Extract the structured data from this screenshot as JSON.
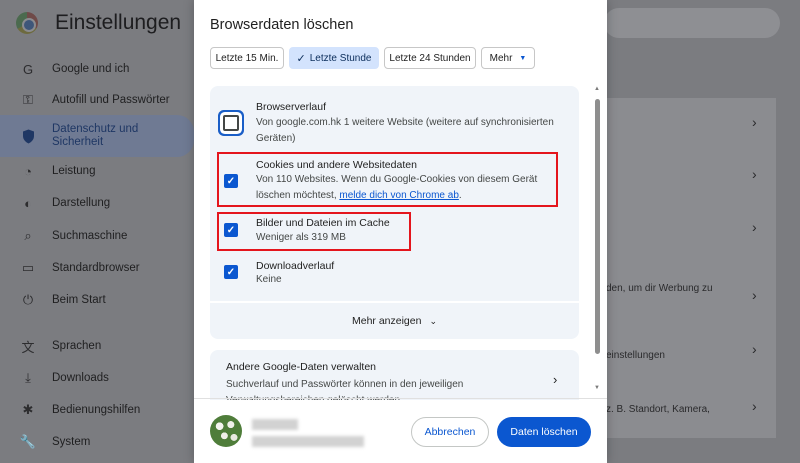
{
  "background": {
    "title": "Einstellungen",
    "sidebar": [
      {
        "label": "Google und ich",
        "icon": "google-icon"
      },
      {
        "label": "Autofill und Passwörter",
        "icon": "key-icon"
      },
      {
        "label": "Datenschutz und\nSicherheit",
        "icon": "shield-icon",
        "active": true
      },
      {
        "label": "Leistung",
        "icon": "speedometer-icon"
      },
      {
        "label": "Darstellung",
        "icon": "palette-icon"
      },
      {
        "label": "Suchmaschine",
        "icon": "search-icon"
      },
      {
        "label": "Standardbrowser",
        "icon": "browser-icon"
      },
      {
        "label": "Beim Start",
        "icon": "power-icon"
      },
      {
        "label": "Sprachen",
        "icon": "translate-icon"
      },
      {
        "label": "Downloads",
        "icon": "download-icon"
      },
      {
        "label": "Bedienungshilfen",
        "icon": "accessibility-icon"
      },
      {
        "label": "System",
        "icon": "wrench-icon"
      }
    ],
    "right_snippets": [
      "den, um dir Werbung zu",
      "einstellungen",
      "z. B. Standort, Kamera,"
    ]
  },
  "dialog": {
    "title": "Browserdaten löschen",
    "time_ranges": [
      {
        "label": "Letzte 15 Min.",
        "selected": false
      },
      {
        "label": "Letzte Stunde",
        "selected": true
      },
      {
        "label": "Letzte 24 Stunden",
        "selected": false
      },
      {
        "label": "Mehr",
        "selected": false,
        "dropdown": true
      }
    ],
    "options": [
      {
        "title": "Browserverlauf",
        "desc": "Von google.com.hk 1 weitere Website (weitere auf synchronisierten Geräten)",
        "checked": false
      },
      {
        "title": "Cookies und andere Websitedaten",
        "desc": "Von 110 Websites. Wenn du Google-Cookies von diesem Gerät löschen möchtest, ",
        "link": "melde dich von Chrome ab",
        "desc_end": ".",
        "checked": true
      },
      {
        "title": "Bilder und Dateien im Cache",
        "desc": "Weniger als 319 MB",
        "checked": true
      },
      {
        "title": "Downloadverlauf",
        "desc": "Keine",
        "checked": true
      }
    ],
    "more_label": "Mehr anzeigen",
    "google_data": {
      "title": "Andere Google-Daten verwalten",
      "desc": "Suchverlauf und Passwörter können in den jeweiligen Verwaltungsbereichen gelöscht werden"
    },
    "cancel_label": "Abbrechen",
    "delete_label": "Daten löschen"
  },
  "colors": {
    "accent": "#0b57d0",
    "highlight": "#e4151d",
    "selected_chip": "#d3e3fd"
  }
}
